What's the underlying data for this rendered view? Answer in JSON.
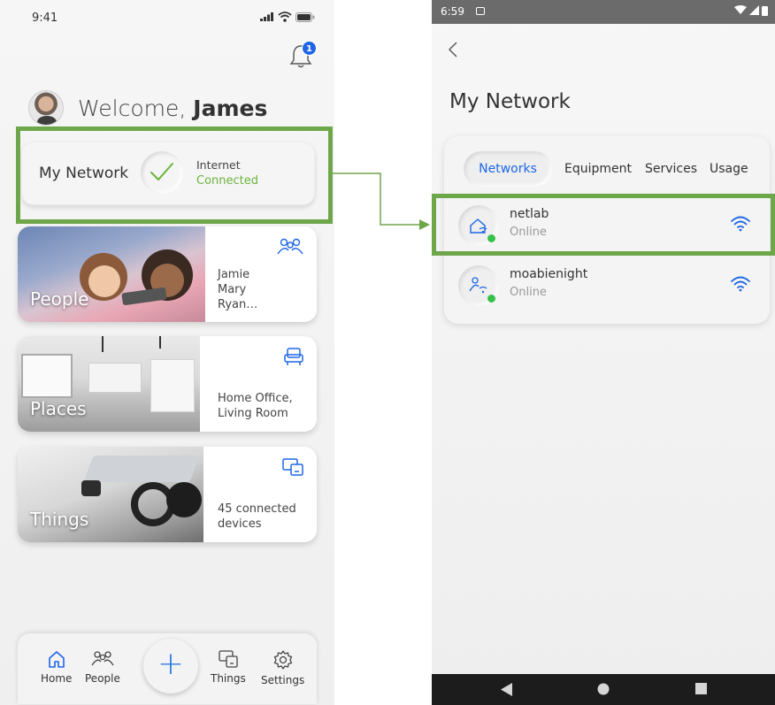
{
  "left": {
    "status": {
      "time": "9:41"
    },
    "notifications": {
      "count": "1"
    },
    "welcome": {
      "greeting": "Welcome,",
      "name": "James"
    },
    "network_card": {
      "title": "My Network",
      "internet_label": "Internet",
      "internet_status": "Connected"
    },
    "cards": {
      "people": {
        "label": "People",
        "info": [
          "Jamie",
          "Mary",
          "Ryan…"
        ]
      },
      "places": {
        "label": "Places",
        "info": [
          "Home Office,",
          "Living Room"
        ]
      },
      "things": {
        "label": "Things",
        "info": [
          "45 connected",
          "devices"
        ]
      }
    },
    "nav": {
      "home": "Home",
      "people": "People",
      "add": "+",
      "things": "Things",
      "settings": "Settings"
    }
  },
  "right": {
    "status": {
      "time": "6:59"
    },
    "title": "My Network",
    "tabs": [
      "Networks",
      "Equipment",
      "Services",
      "Usage"
    ],
    "networks": [
      {
        "name": "netlab",
        "status": "Online"
      },
      {
        "name": "moabienight",
        "status": "Online"
      }
    ]
  },
  "colors": {
    "accent": "#1e66e6",
    "connected": "#6bb33b",
    "highlight": "#6ea64a",
    "online_dot": "#36c24a"
  }
}
